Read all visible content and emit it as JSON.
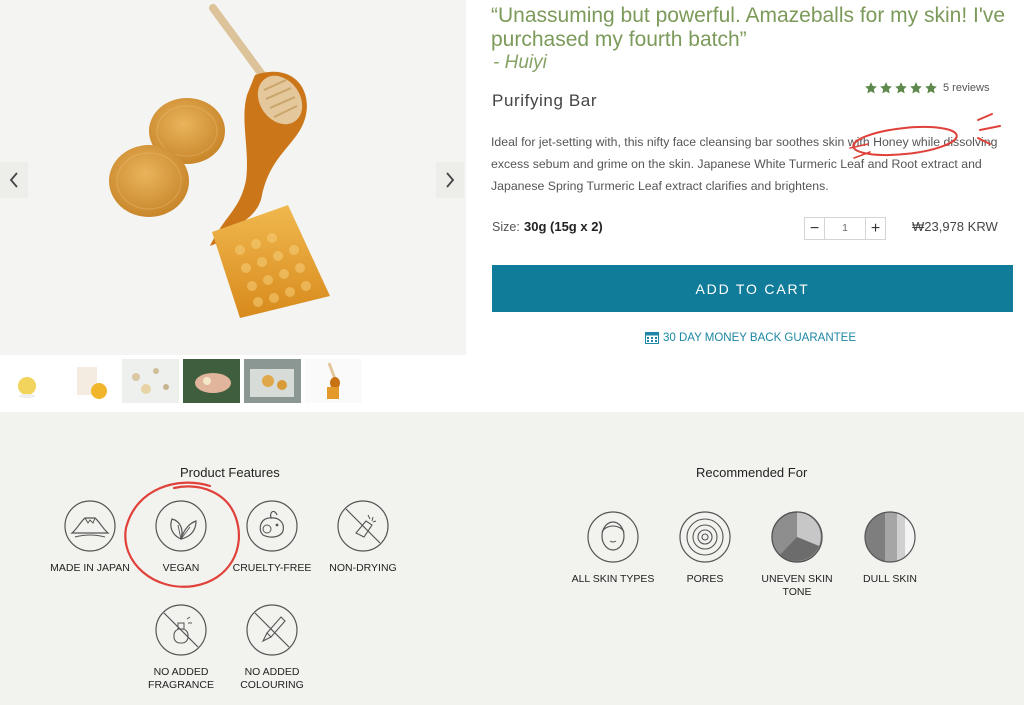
{
  "gallery": {
    "prev_icon": "chevron-left-icon",
    "next_icon": "chevron-right-icon",
    "thumbnails": [
      "thumb-1",
      "thumb-2",
      "thumb-3",
      "thumb-4",
      "thumb-5",
      "thumb-6"
    ]
  },
  "quote": {
    "text": "“Unassuming but powerful. Amazeballs for my skin! I've purchased my fourth batch”",
    "author": "- Huiyi"
  },
  "product": {
    "name": "Purifying Bar",
    "rating": 5,
    "reviews_label": "5 reviews",
    "description": "Ideal for jet-setting with, this nifty face cleansing bar soothes skin with Honey while dissolving excess sebum and grime on the skin. Japanese White Turmeric Leaf and Root extract and Japanese Spring Turmeric Leaf extract clarifies and brightens.",
    "size_label": "Size:",
    "size_value": "30g (15g x 2)",
    "quantity": "1",
    "qty_minus": "−",
    "qty_plus": "+",
    "price": "₩23,978 KRW",
    "add_to_cart": "ADD TO CART",
    "guarantee": "30 DAY MONEY BACK GUARANTEE"
  },
  "features": {
    "title": "Product Features",
    "items": [
      {
        "label": "MADE IN JAPAN",
        "icon": "mount-fuji-icon"
      },
      {
        "label": "VEGAN",
        "icon": "leaves-icon"
      },
      {
        "label": "CRUELTY-FREE",
        "icon": "rabbit-icon"
      },
      {
        "label": "NON-DRYING",
        "icon": "no-drying-icon"
      },
      {
        "label": "NO ADDED FRAGRANCE",
        "icon": "no-fragrance-icon"
      },
      {
        "label": "NO ADDED COLOURING",
        "icon": "no-colouring-icon"
      }
    ]
  },
  "recommended": {
    "title": "Recommended For",
    "items": [
      {
        "label": "ALL SKIN TYPES",
        "icon": "face-icon"
      },
      {
        "label": "PORES",
        "icon": "pores-icon"
      },
      {
        "label": "UNEVEN SKIN TONE",
        "icon": "uneven-tone-icon"
      },
      {
        "label": "DULL SKIN",
        "icon": "dull-skin-icon"
      }
    ]
  },
  "colors": {
    "accent": "#117c99",
    "quote": "#7c9a5a",
    "stars": "#5d8a4c",
    "annotation": "#e0413a",
    "section_bg": "#f2f3ee"
  }
}
